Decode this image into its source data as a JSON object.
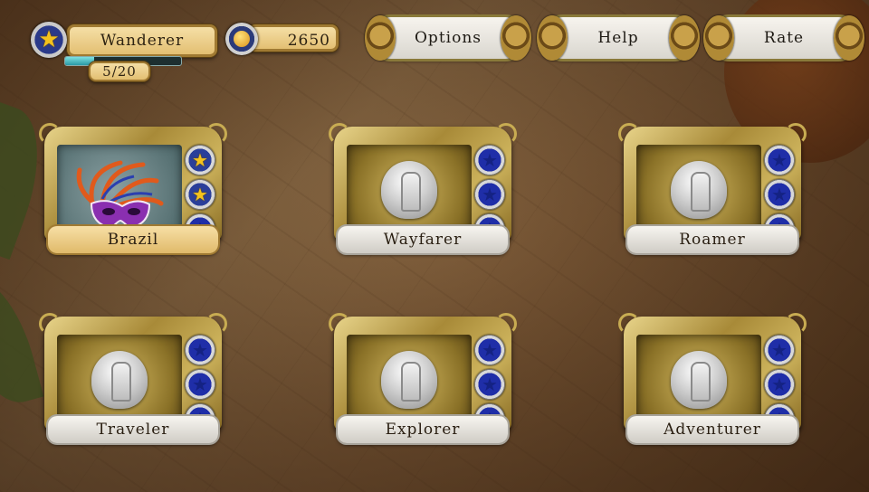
{
  "player": {
    "rank": "Wanderer",
    "progress_text": "5/20",
    "progress_fraction": 0.25,
    "rank_icon": "star-icon"
  },
  "currency": {
    "amount": "2650",
    "icon": "coin-icon"
  },
  "menu": {
    "options": "Options",
    "help": "Help",
    "rate": "Rate"
  },
  "levels": [
    {
      "name": "Brazil",
      "unlocked": true,
      "stars_earned": 2,
      "stars_total": 3
    },
    {
      "name": "Wayfarer",
      "unlocked": false,
      "stars_earned": 0,
      "stars_total": 3
    },
    {
      "name": "Roamer",
      "unlocked": false,
      "stars_earned": 0,
      "stars_total": 3
    },
    {
      "name": "Traveler",
      "unlocked": false,
      "stars_earned": 0,
      "stars_total": 3
    },
    {
      "name": "Explorer",
      "unlocked": false,
      "stars_earned": 0,
      "stars_total": 3
    },
    {
      "name": "Adventurer",
      "unlocked": false,
      "stars_earned": 0,
      "stars_total": 3
    }
  ],
  "colors": {
    "gold": "#c9a14a",
    "gem_blue": "#1f2ea8",
    "star_gold": "#f4c21c",
    "xp_teal": "#2a9aa6"
  }
}
